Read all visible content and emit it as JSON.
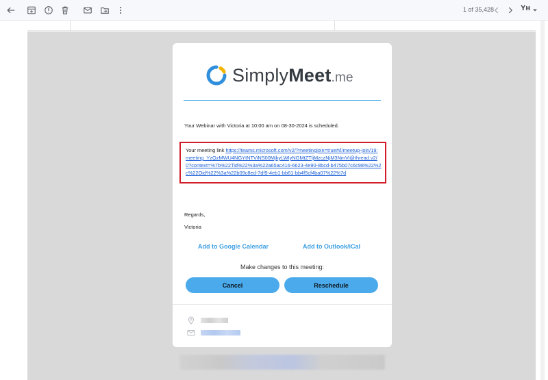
{
  "toolbar": {
    "icons": [
      "back-arrow-icon",
      "archive-icon",
      "report-spam-icon",
      "delete-icon",
      "mark-unread-icon",
      "move-to-icon",
      "more-vert-icon"
    ],
    "pager_text": "1 of 35,428",
    "keyboard_label": "Yн"
  },
  "email": {
    "logo": {
      "brand_prefix": "Simply",
      "brand_bold": "Meet",
      "brand_suffix": ".me",
      "accent_color": "#3ea6e6",
      "ring_colors": [
        "#2f8fdc",
        "#f4b400"
      ]
    },
    "scheduled_text": "Your Webinar with Victoria at 10:00 am on 08-30-2024 is scheduled.",
    "meeting_link_label": "Your meeting link ",
    "meeting_link_url": "https://teams.microsoft.com/v2/?meetingjoin=true#/l/meetup-join/19:meeting_YzQzMWU4NGYtNTViNS00MjkyLWIyNGMtZTljMzczNjM3NmVi@thread.v2/0?context=%7b%22Tid%22%3a%22a65ac416-6623-4e90-8bcd-b475b07c6c98%22%2c%22Oid%22%3a%22b09c8ed-7df9-4eb1-bb61-bb4f5cf4ba07%22%7d",
    "highlight_color": "#d21e2b",
    "regards": "Regards,",
    "signer": "Victoria",
    "add_google": "Add to Google Calendar",
    "add_outlook": "Add to Outlook/iCal",
    "make_changes": "Make changes to this meeting:",
    "cancel_label": "Cancel",
    "reschedule_label": "Reschedule",
    "button_color": "#4aaaeb",
    "footer_icons": [
      "location-pin-icon",
      "mail-icon"
    ]
  }
}
